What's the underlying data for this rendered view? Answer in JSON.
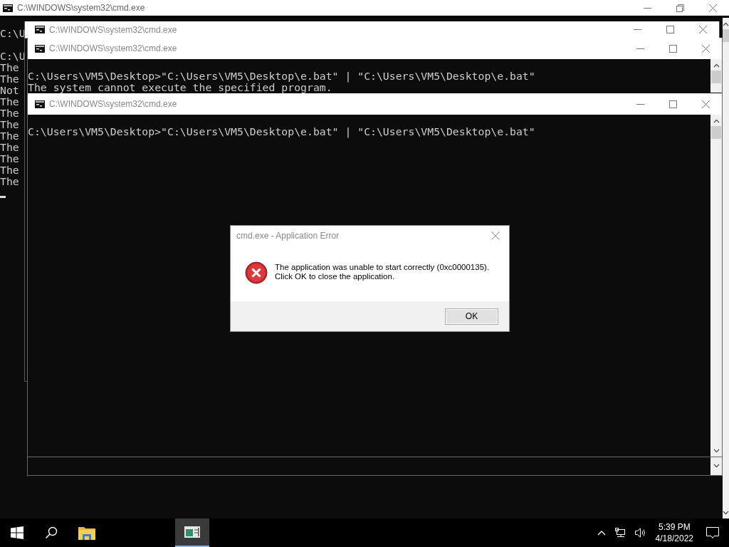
{
  "windows": [
    {
      "title": "C:\\WINDOWS\\system32\\cmd.exe",
      "maximized": true,
      "cursor": true,
      "blocks": [
        [
          "C:\\U"
        ],
        [
          "C:\\U",
          "The",
          "The",
          "Not",
          "The",
          "The",
          "The",
          "The",
          "The",
          "The",
          "The",
          "The"
        ]
      ]
    },
    {
      "title": "C:\\WINDOWS\\system32\\cmd.exe",
      "maximized": false,
      "cursor": false
    },
    {
      "title": "C:\\WINDOWS\\system32\\cmd.exe",
      "maximized": false,
      "cursor": false,
      "blocks": [
        [
          "C:\\Users\\VM5\\Desktop>\"C:\\Users\\VM5\\Desktop\\e.bat\" | \"C:\\Users\\VM5\\Desktop\\e.bat\"",
          "The system cannot execute the specified program."
        ]
      ]
    },
    {
      "title": "C:\\WINDOWS\\system32\\cmd.exe",
      "maximized": false,
      "cursor": false,
      "blocks": [
        [
          "C:\\Users\\VM5\\Desktop>\"C:\\Users\\VM5\\Desktop\\e.bat\" | \"C:\\Users\\VM5\\Desktop\\e.bat\""
        ]
      ]
    }
  ],
  "dialog": {
    "title": "cmd.exe - Application Error",
    "message": "The application was unable to start correctly (0xc0000135). Click OK to close the application.",
    "button": "OK"
  },
  "taskbar": {
    "items": [
      {
        "kind": "start",
        "selected": false
      },
      {
        "kind": "search",
        "selected": false
      },
      {
        "kind": "explorer",
        "selected": false
      },
      {
        "kind": "cmd",
        "selected": true
      }
    ],
    "time": "5:39 PM",
    "date": "4/18/2022"
  }
}
